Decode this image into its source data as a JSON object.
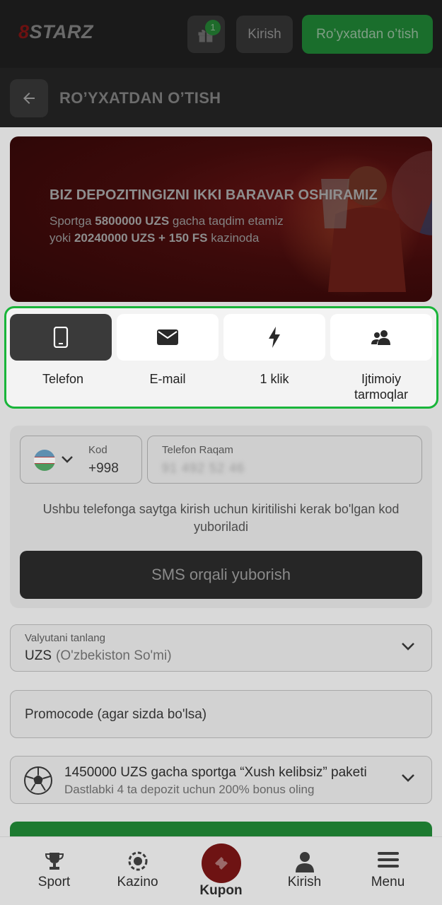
{
  "header": {
    "logo_text": "8STARZ",
    "gift_badge": "1",
    "login_label": "Kirish",
    "register_label": "Ro’yxatdan o’tish"
  },
  "subheader": {
    "title": "RO’YXATDAN O’TISH"
  },
  "banner": {
    "title": "BIZ DEPOZITINGIZNI IKKI BARAVAR OSHIRAMIZ",
    "line1_pre": "Sportga ",
    "line1_bold": "5800000 UZS",
    "line1_post": " gacha taqdim etamiz",
    "line2_pre": "yoki ",
    "line2_bold": "20240000 UZS + 150 FS",
    "line2_post": " kazinoda"
  },
  "tabs": [
    {
      "label": "Telefon",
      "icon": "phone-icon",
      "active": true
    },
    {
      "label": "E-mail",
      "icon": "envelope-icon",
      "active": false
    },
    {
      "label": "1 klik",
      "icon": "bolt-icon",
      "active": false
    },
    {
      "label_line1": "Ijtimoiy",
      "label_line2": "tarmoqlar",
      "icon": "users-icon",
      "active": false
    }
  ],
  "phone_form": {
    "code_label": "Kod",
    "code_value": "+998",
    "phone_label": "Telefon Raqam",
    "phone_value": "91 492 52 46",
    "hint": "Ushbu telefonga saytga kirish uchun kiritilishi kerak bo'lgan kod yuboriladi",
    "sms_button": "SMS orqali yuborish"
  },
  "currency": {
    "label": "Valyutani tanlang",
    "code": "UZS",
    "name": "(O'zbekiston So'mi)"
  },
  "promo": {
    "placeholder": "Promocode (agar sizda bo'lsa)"
  },
  "bonus": {
    "title": "1450000 UZS gacha sportga “Xush kelibsiz” paketi",
    "subtitle": "Dastlabki 4 ta depozit uchun 200% bonus oling"
  },
  "bottom_nav": {
    "sport": "Sport",
    "kazino": "Kazino",
    "kupon": "Kupon",
    "kirish": "Kirish",
    "menu": "Menu"
  },
  "colors": {
    "accent_green": "#19b53a",
    "brand_red": "#c01818",
    "overlay_dark": "#1a1a1a"
  }
}
